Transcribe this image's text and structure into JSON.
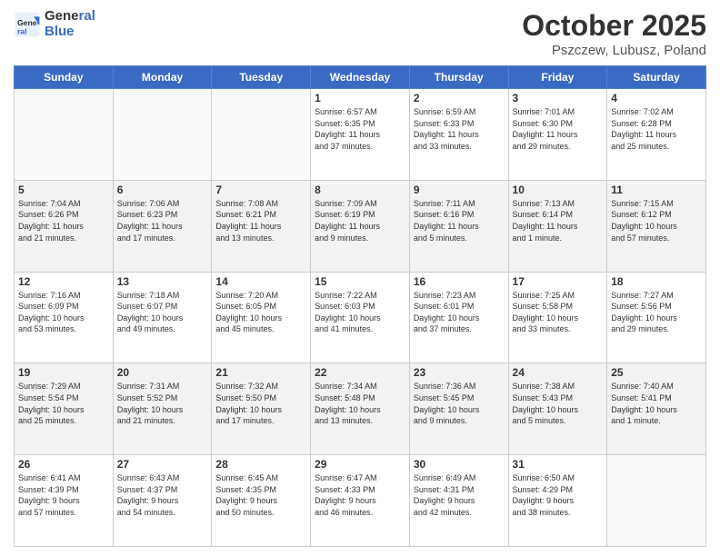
{
  "logo": {
    "line1": "General",
    "line2": "Blue"
  },
  "title": "October 2025",
  "location": "Pszczew, Lubusz, Poland",
  "days_of_week": [
    "Sunday",
    "Monday",
    "Tuesday",
    "Wednesday",
    "Thursday",
    "Friday",
    "Saturday"
  ],
  "weeks": [
    [
      {
        "day": "",
        "info": ""
      },
      {
        "day": "",
        "info": ""
      },
      {
        "day": "",
        "info": ""
      },
      {
        "day": "1",
        "info": "Sunrise: 6:57 AM\nSunset: 6:35 PM\nDaylight: 11 hours\nand 37 minutes."
      },
      {
        "day": "2",
        "info": "Sunrise: 6:59 AM\nSunset: 6:33 PM\nDaylight: 11 hours\nand 33 minutes."
      },
      {
        "day": "3",
        "info": "Sunrise: 7:01 AM\nSunset: 6:30 PM\nDaylight: 11 hours\nand 29 minutes."
      },
      {
        "day": "4",
        "info": "Sunrise: 7:02 AM\nSunset: 6:28 PM\nDaylight: 11 hours\nand 25 minutes."
      }
    ],
    [
      {
        "day": "5",
        "info": "Sunrise: 7:04 AM\nSunset: 6:26 PM\nDaylight: 11 hours\nand 21 minutes."
      },
      {
        "day": "6",
        "info": "Sunrise: 7:06 AM\nSunset: 6:23 PM\nDaylight: 11 hours\nand 17 minutes."
      },
      {
        "day": "7",
        "info": "Sunrise: 7:08 AM\nSunset: 6:21 PM\nDaylight: 11 hours\nand 13 minutes."
      },
      {
        "day": "8",
        "info": "Sunrise: 7:09 AM\nSunset: 6:19 PM\nDaylight: 11 hours\nand 9 minutes."
      },
      {
        "day": "9",
        "info": "Sunrise: 7:11 AM\nSunset: 6:16 PM\nDaylight: 11 hours\nand 5 minutes."
      },
      {
        "day": "10",
        "info": "Sunrise: 7:13 AM\nSunset: 6:14 PM\nDaylight: 11 hours\nand 1 minute."
      },
      {
        "day": "11",
        "info": "Sunrise: 7:15 AM\nSunset: 6:12 PM\nDaylight: 10 hours\nand 57 minutes."
      }
    ],
    [
      {
        "day": "12",
        "info": "Sunrise: 7:16 AM\nSunset: 6:09 PM\nDaylight: 10 hours\nand 53 minutes."
      },
      {
        "day": "13",
        "info": "Sunrise: 7:18 AM\nSunset: 6:07 PM\nDaylight: 10 hours\nand 49 minutes."
      },
      {
        "day": "14",
        "info": "Sunrise: 7:20 AM\nSunset: 6:05 PM\nDaylight: 10 hours\nand 45 minutes."
      },
      {
        "day": "15",
        "info": "Sunrise: 7:22 AM\nSunset: 6:03 PM\nDaylight: 10 hours\nand 41 minutes."
      },
      {
        "day": "16",
        "info": "Sunrise: 7:23 AM\nSunset: 6:01 PM\nDaylight: 10 hours\nand 37 minutes."
      },
      {
        "day": "17",
        "info": "Sunrise: 7:25 AM\nSunset: 5:58 PM\nDaylight: 10 hours\nand 33 minutes."
      },
      {
        "day": "18",
        "info": "Sunrise: 7:27 AM\nSunset: 5:56 PM\nDaylight: 10 hours\nand 29 minutes."
      }
    ],
    [
      {
        "day": "19",
        "info": "Sunrise: 7:29 AM\nSunset: 5:54 PM\nDaylight: 10 hours\nand 25 minutes."
      },
      {
        "day": "20",
        "info": "Sunrise: 7:31 AM\nSunset: 5:52 PM\nDaylight: 10 hours\nand 21 minutes."
      },
      {
        "day": "21",
        "info": "Sunrise: 7:32 AM\nSunset: 5:50 PM\nDaylight: 10 hours\nand 17 minutes."
      },
      {
        "day": "22",
        "info": "Sunrise: 7:34 AM\nSunset: 5:48 PM\nDaylight: 10 hours\nand 13 minutes."
      },
      {
        "day": "23",
        "info": "Sunrise: 7:36 AM\nSunset: 5:45 PM\nDaylight: 10 hours\nand 9 minutes."
      },
      {
        "day": "24",
        "info": "Sunrise: 7:38 AM\nSunset: 5:43 PM\nDaylight: 10 hours\nand 5 minutes."
      },
      {
        "day": "25",
        "info": "Sunrise: 7:40 AM\nSunset: 5:41 PM\nDaylight: 10 hours\nand 1 minute."
      }
    ],
    [
      {
        "day": "26",
        "info": "Sunrise: 6:41 AM\nSunset: 4:39 PM\nDaylight: 9 hours\nand 57 minutes."
      },
      {
        "day": "27",
        "info": "Sunrise: 6:43 AM\nSunset: 4:37 PM\nDaylight: 9 hours\nand 54 minutes."
      },
      {
        "day": "28",
        "info": "Sunrise: 6:45 AM\nSunset: 4:35 PM\nDaylight: 9 hours\nand 50 minutes."
      },
      {
        "day": "29",
        "info": "Sunrise: 6:47 AM\nSunset: 4:33 PM\nDaylight: 9 hours\nand 46 minutes."
      },
      {
        "day": "30",
        "info": "Sunrise: 6:49 AM\nSunset: 4:31 PM\nDaylight: 9 hours\nand 42 minutes."
      },
      {
        "day": "31",
        "info": "Sunrise: 6:50 AM\nSunset: 4:29 PM\nDaylight: 9 hours\nand 38 minutes."
      },
      {
        "day": "",
        "info": ""
      }
    ]
  ]
}
